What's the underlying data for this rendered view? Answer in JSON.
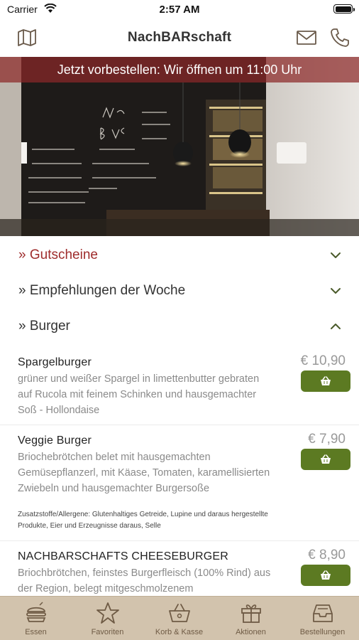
{
  "status_bar": {
    "carrier": "Carrier",
    "time": "2:57 AM"
  },
  "nav": {
    "title": "NachBARschaft"
  },
  "hero": {
    "banner": "Jetzt vorbestellen: Wir öffnen um 11:00 Uhr"
  },
  "sections": [
    {
      "label": "» Gutscheine",
      "state": "collapsed",
      "active": true
    },
    {
      "label": "» Empfehlungen der Woche",
      "state": "collapsed",
      "active": false
    },
    {
      "label": "» Burger",
      "state": "expanded",
      "active": false
    }
  ],
  "items": [
    {
      "name": "Spargelburger",
      "description": "grüner und weißer Spargel in limettenbutter gebraten auf Rucola mit feinem Schinken und hausgemachter Soß - Hollondaise",
      "price": "€ 10,90",
      "allergens": ""
    },
    {
      "name": "Veggie Burger",
      "description": "Briochebrötchen belet mit hausgemachten Gemüsepflanzerl, mit Käase, Tomaten, karamellisierten Zwiebeln und hausgemachter Burgersoße",
      "price": "€ 7,90",
      "allergens": "Zusatzstoffe/Allergene: Glutenhaltiges Getreide, Lupine und daraus hergestellte Produkte, Eier und Erzeugnisse daraus, Selle"
    },
    {
      "name": "NACHBARSCHAFTS CHEESEBURGER",
      "description": "Briochbrötchen, feinstes Burgerfleisch (100% Rind) aus der Region, belegt mitgeschmolzenem",
      "price": "€ 8,90",
      "allergens": ""
    }
  ],
  "tabs": [
    {
      "label": "Essen",
      "icon": "burger-icon"
    },
    {
      "label": "Favoriten",
      "icon": "star-icon"
    },
    {
      "label": "Korb & Kasse",
      "icon": "basket-icon"
    },
    {
      "label": "Aktionen",
      "icon": "gift-icon"
    },
    {
      "label": "Bestellungen",
      "icon": "inbox-icon"
    }
  ],
  "colors": {
    "accent_red": "#9e2b2b",
    "cart_green": "#5c7a22",
    "tab_bar": "#d2c3ad",
    "banner": "#8c2828"
  }
}
